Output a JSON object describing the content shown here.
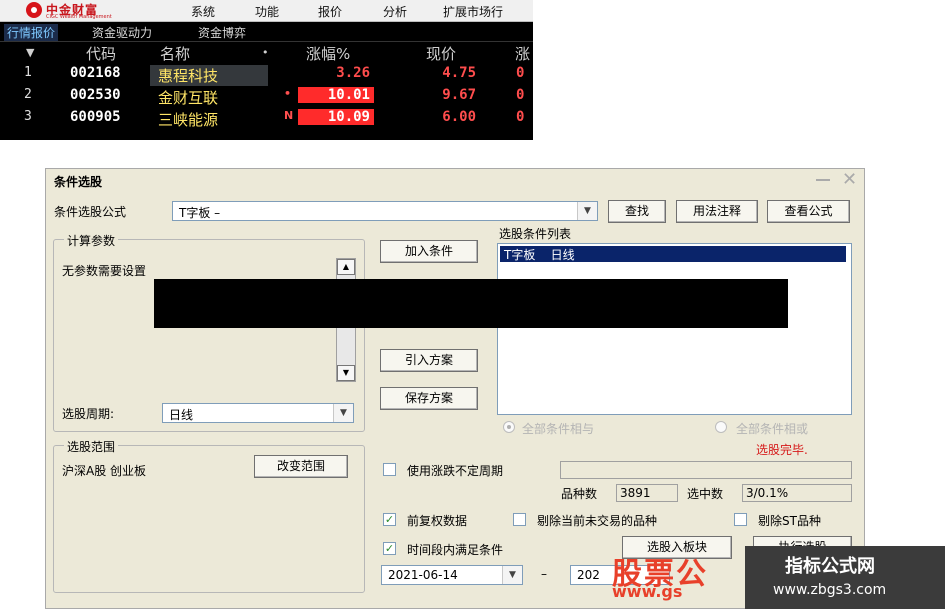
{
  "app": {
    "logo_text": "中金财富",
    "logo_sub": "CIGC Wealth Management",
    "menu": [
      "系统",
      "功能",
      "报价",
      "分析",
      "扩展市场行"
    ],
    "tabs": [
      "行情报价",
      "资金驱动力",
      "资金博弈"
    ],
    "columns": [
      "代码",
      "名称",
      "•",
      "涨幅%",
      "现价",
      "涨"
    ],
    "rows": [
      {
        "n": "1",
        "code": "002168",
        "name": "惠程科技",
        "flag": "",
        "pct": "3.26",
        "price": "4.75",
        "rest": "0"
      },
      {
        "n": "2",
        "code": "002530",
        "name": "金财互联",
        "flag": "•",
        "pct": "10.01",
        "price": "9.67",
        "rest": "0"
      },
      {
        "n": "3",
        "code": "600905",
        "name": "三峡能源",
        "flag": "N",
        "pct": "10.09",
        "price": "6.00",
        "rest": "0"
      }
    ]
  },
  "dialog": {
    "title": "条件选股",
    "formula_label": "条件选股公式",
    "formula_value": "T字板          –",
    "btn_find": "查找",
    "btn_usage": "用法注释",
    "btn_view": "查看公式",
    "params_group": "计算参数",
    "params_text": "无参数需要设置",
    "btn_add": "加入条件",
    "btn_import": "引入方案",
    "btn_save": "保存方案",
    "list_label": "选股条件列表",
    "list_items": [
      "T字板    日线"
    ],
    "period_label": "选股周期:",
    "period_value": "日线",
    "radio_and": "全部条件相与",
    "radio_or": "全部条件相或",
    "status": "选股完毕.",
    "range_group": "选股范围",
    "range_text": "沪深A股 创业板",
    "btn_change_range": "改变范围",
    "use_period_label": "使用涨跌不定周期",
    "count_label": "品种数",
    "count_value": "3891",
    "selected_label": "选中数",
    "selected_value": "3/0.1%",
    "chk_prior": "前复权数据",
    "chk_exclude_notrade": "剔除当前未交易的品种",
    "chk_exclude_st": "剔除ST品种",
    "chk_time": "时间段内满足条件",
    "btn_to_block": "选股入板块",
    "btn_execute": "执行选股",
    "date_from": "2021-06-14",
    "date_sep": "–",
    "date_to": "202"
  },
  "watermark": {
    "left_big": "股票公",
    "left_small": "www.gs",
    "right_title": "指标公式网",
    "right_url": "www.zbgs3.com"
  }
}
